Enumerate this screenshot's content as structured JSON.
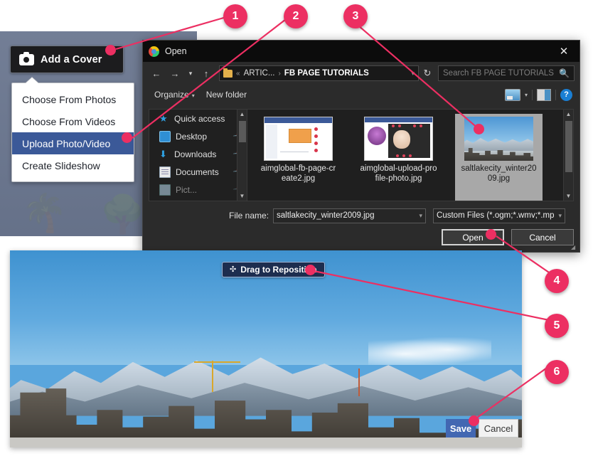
{
  "facebook": {
    "add_cover_button": "Add a Cover",
    "camera_icon": "camera-icon",
    "menu_items": [
      {
        "label": "Choose From Photos",
        "selected": false
      },
      {
        "label": "Choose From Videos",
        "selected": false
      },
      {
        "label": "Upload Photo/Video",
        "selected": true
      },
      {
        "label": "Create Slideshow",
        "selected": false
      }
    ],
    "reposition_button": "Drag to Reposition",
    "reposition_icon": "move-icon",
    "save_button": "Save",
    "cancel_button": "Cancel"
  },
  "dialog": {
    "title": "Open",
    "app_icon": "chrome-icon",
    "close_icon": "close-icon",
    "nav": {
      "back_icon": "arrow-left-icon",
      "forward_icon": "arrow-right-icon",
      "recent_icon": "chevron-down-icon",
      "up_icon": "arrow-up-icon",
      "folder_icon": "folder-icon",
      "overflow": "«",
      "crumbs": [
        "ARTIC...",
        "FB PAGE TUTORIALS"
      ],
      "separator": "›",
      "dropdown_icon": "chevron-down-icon",
      "refresh_icon": "refresh-icon"
    },
    "search": {
      "placeholder": "Search FB PAGE TUTORIALS",
      "icon": "search-icon"
    },
    "toolbar": {
      "organize": "Organize",
      "organize_caret": "▾",
      "new_folder": "New folder",
      "view_icon": "view-layout-icon",
      "view_caret": "▾",
      "preview_icon": "preview-pane-icon",
      "help_icon": "help-icon",
      "help_glyph": "?"
    },
    "sidebar": [
      {
        "label": "Quick access",
        "icon": "star-icon",
        "pinned": false
      },
      {
        "label": "Desktop",
        "icon": "desktop-icon",
        "pinned": true
      },
      {
        "label": "Downloads",
        "icon": "download-icon",
        "pinned": true
      },
      {
        "label": "Documents",
        "icon": "documents-icon",
        "pinned": true
      },
      {
        "label": "Pict...",
        "icon": "pictures-icon",
        "pinned": true
      }
    ],
    "files": [
      {
        "name": "aimglobal-fb-page-create2.jpg",
        "selected": false,
        "thumb": "screenshot-diagram-thumb"
      },
      {
        "name": "aimglobal-upload-profile-photo.jpg",
        "selected": false,
        "thumb": "screenshot-profile-thumb"
      },
      {
        "name": "saltlakecity_winter2009.jpg",
        "selected": true,
        "thumb": "saltlake-city-thumb"
      }
    ],
    "filename_label": "File name:",
    "filename_value": "saltlakecity_winter2009.jpg",
    "filetype_value": "Custom Files (*.ogm;*.wmv;*.mp",
    "open_button": "Open",
    "cancel_button": "Cancel",
    "scrollbar_up": "▲",
    "scrollbar_down": "▼",
    "resize_grip": "resize-grip-icon"
  },
  "callouts": [
    {
      "number": "1"
    },
    {
      "number": "2"
    },
    {
      "number": "3"
    },
    {
      "number": "4"
    },
    {
      "number": "5"
    },
    {
      "number": "6"
    }
  ],
  "colors": {
    "callout": "#ec2f62",
    "fb_blue": "#3b5998",
    "fb_save": "#4267b2",
    "dialog_bg": "#2b2b2b"
  }
}
